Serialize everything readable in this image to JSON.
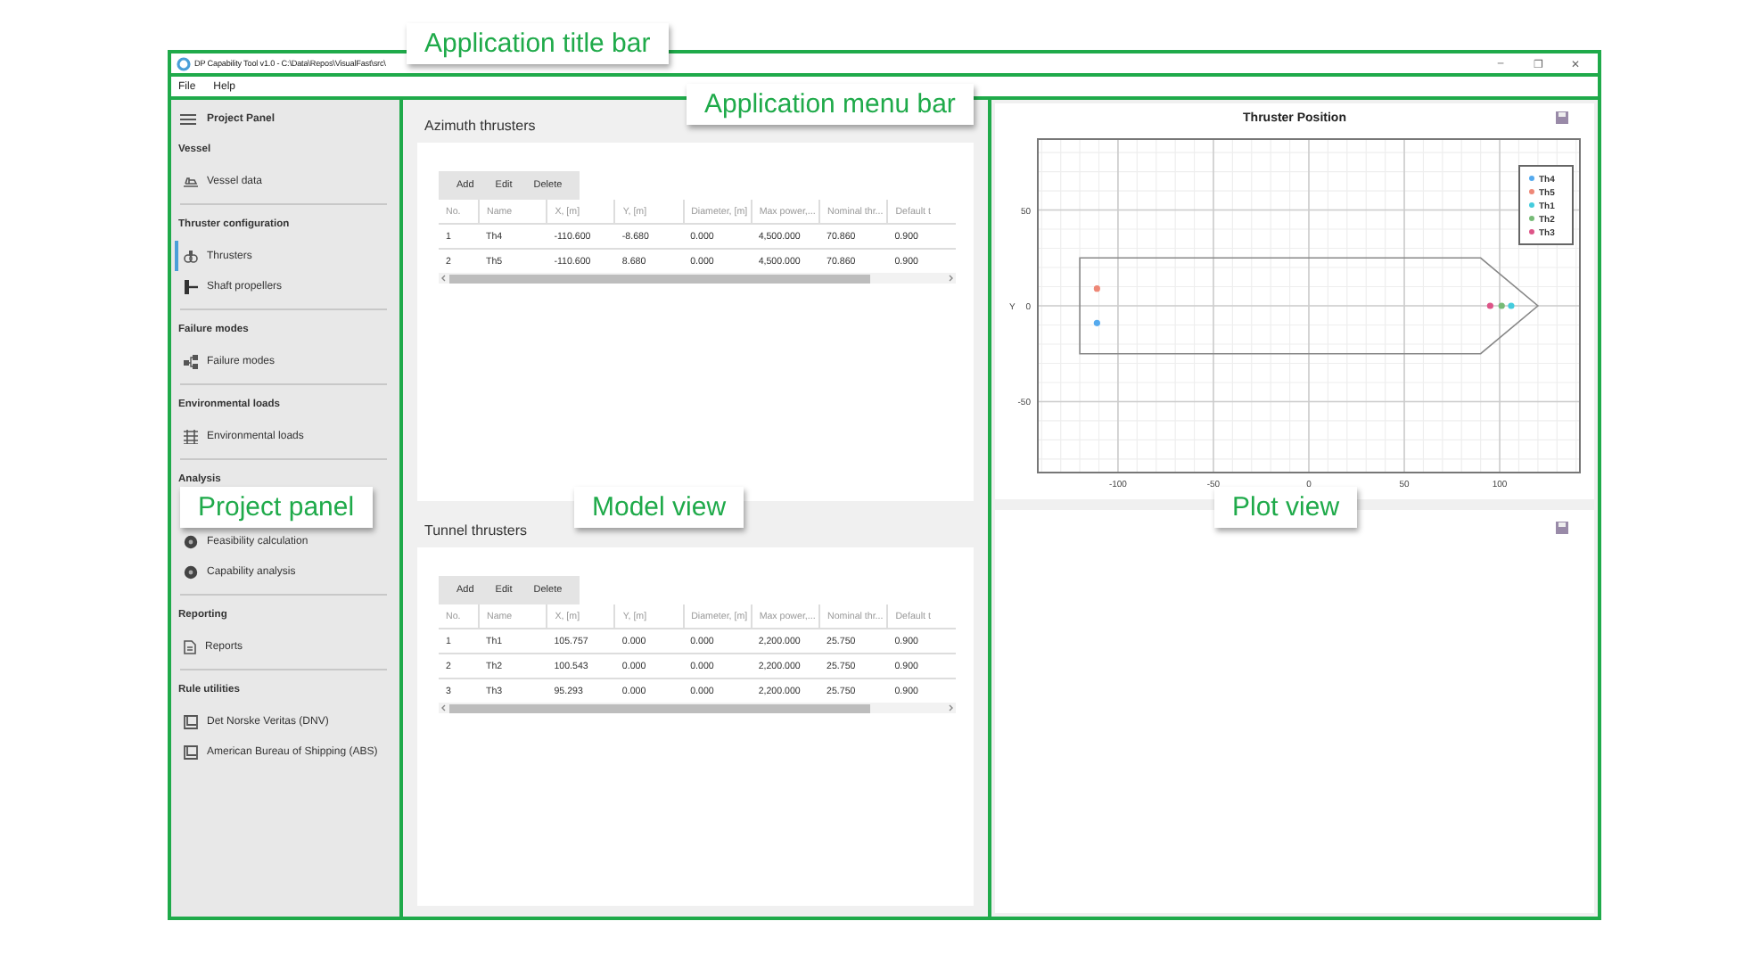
{
  "window": {
    "title": "DP Capability Tool v1.0 - C:\\Data\\Repos\\VisualFast\\src\\",
    "controls": [
      "–",
      "❐",
      "✕"
    ]
  },
  "menu": [
    "File",
    "Help"
  ],
  "sidebar": {
    "title": "Project Panel",
    "sections": [
      {
        "heading": "Vessel",
        "items": [
          {
            "label": "Vessel data",
            "kind": "ship",
            "selected": false
          }
        ]
      },
      {
        "heading": "Thruster configuration",
        "items": [
          {
            "label": "Thrusters",
            "kind": "thruster",
            "selected": true
          },
          {
            "label": "Shaft propellers",
            "kind": "shaft",
            "selected": false
          }
        ]
      },
      {
        "heading": "Failure modes",
        "items": [
          {
            "label": "Failure modes",
            "kind": "tree",
            "selected": false
          }
        ]
      },
      {
        "heading": "Environmental loads",
        "items": [
          {
            "label": "Environmental loads",
            "kind": "grid",
            "selected": false
          }
        ]
      },
      {
        "heading": "Analysis",
        "items": [
          {
            "label": "Feasibility calculation",
            "kind": "disc",
            "selected": false
          },
          {
            "label": "Capability analysis",
            "kind": "disc",
            "selected": false
          }
        ]
      },
      {
        "heading": "Reporting",
        "items": [
          {
            "label": "Reports",
            "kind": "doc",
            "selected": false
          }
        ]
      },
      {
        "heading": "Rule utilities",
        "items": [
          {
            "label": "Det Norske Veritas (DNV)",
            "kind": "book",
            "selected": false
          },
          {
            "label": "American Bureau of Shipping (ABS)",
            "kind": "book",
            "selected": false
          }
        ]
      }
    ]
  },
  "tables": [
    {
      "title": "Azimuth thrusters",
      "buttons": [
        "Add",
        "Edit",
        "Delete"
      ],
      "columns": [
        "No.",
        "Name",
        "X, [m]",
        "Y, [m]",
        "Diameter, [m]",
        "Max power,...",
        "Nominal thr...",
        "Default t"
      ],
      "rows": [
        [
          "1",
          "Th4",
          "-110.600",
          "-8.680",
          "0.000",
          "4,500.000",
          "70.860",
          "0.900"
        ],
        [
          "2",
          "Th5",
          "-110.600",
          "8.680",
          "0.000",
          "4,500.000",
          "70.860",
          "0.900"
        ]
      ]
    },
    {
      "title": "Tunnel thrusters",
      "buttons": [
        "Add",
        "Edit",
        "Delete"
      ],
      "columns": [
        "No.",
        "Name",
        "X, [m]",
        "Y, [m]",
        "Diameter, [m]",
        "Max power,...",
        "Nominal thr...",
        "Default t"
      ],
      "rows": [
        [
          "1",
          "Th1",
          "105.757",
          "0.000",
          "0.000",
          "2,200.000",
          "25.750",
          "0.900"
        ],
        [
          "2",
          "Th2",
          "100.543",
          "0.000",
          "0.000",
          "2,200.000",
          "25.750",
          "0.900"
        ],
        [
          "3",
          "Th3",
          "95.293",
          "0.000",
          "0.000",
          "2,200.000",
          "25.750",
          "0.900"
        ]
      ]
    }
  ],
  "plot": {
    "chart_data": {
      "type": "scatter",
      "title": "Thruster Position",
      "ylabel": "Y",
      "xlim": [
        -142,
        142
      ],
      "ylim": [
        -87,
        87
      ],
      "xticks": [
        -100,
        -50,
        0,
        50,
        100
      ],
      "yticks": [
        50,
        0,
        -50
      ],
      "grid": true,
      "legend": "upper right",
      "series": [
        {
          "name": "Th4",
          "color": "#55aaee",
          "x": [
            -111
          ],
          "values": [
            -9
          ]
        },
        {
          "name": "Th5",
          "color": "#ee8877",
          "x": [
            -111
          ],
          "values": [
            9
          ]
        },
        {
          "name": "Th1",
          "color": "#44ccdd",
          "x": [
            106
          ],
          "values": [
            0
          ]
        },
        {
          "name": "Th2",
          "color": "#77bb77",
          "x": [
            101
          ],
          "values": [
            0
          ]
        },
        {
          "name": "Th3",
          "color": "#dd5588",
          "x": [
            95
          ],
          "values": [
            0
          ]
        }
      ]
    }
  },
  "callouts": [
    {
      "kind": "title",
      "text": "Application title bar"
    },
    {
      "kind": "menu",
      "text": "Application menu bar"
    },
    {
      "kind": "panel",
      "text": "Project panel"
    },
    {
      "kind": "model",
      "text": "Model view"
    },
    {
      "kind": "plot",
      "text": "Plot view"
    }
  ]
}
